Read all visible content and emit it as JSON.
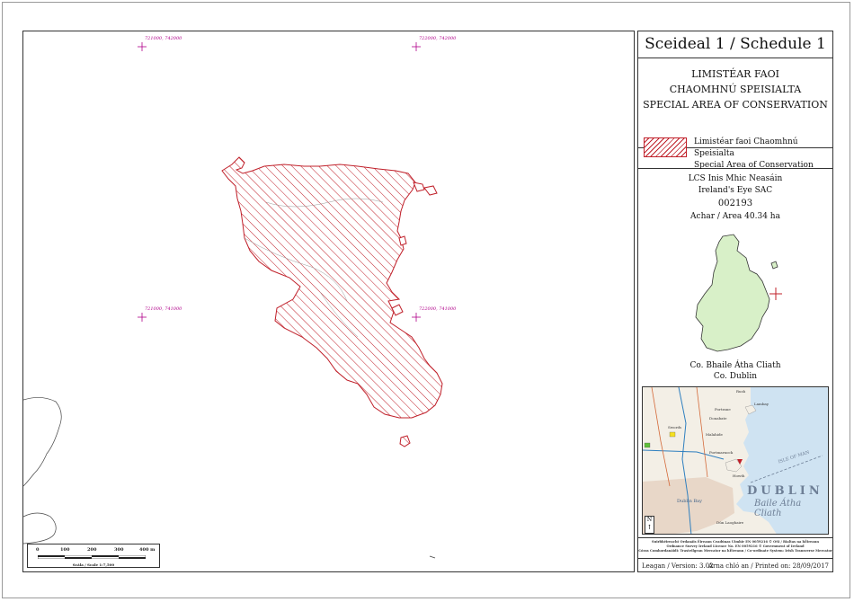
{
  "map": {
    "grid_labels": [
      "721000, 742000",
      "722000, 742000",
      "721000, 741000",
      "722000, 741000"
    ],
    "scale_ticks": [
      "0",
      "100",
      "200",
      "300",
      "400 m"
    ],
    "scale_caption": "Scála / Scale 1:7,500"
  },
  "panel": {
    "title": "Sceideal 1 / Schedule 1",
    "designation_lines": [
      "LIMISTÉAR FAOI",
      "CHAOMHNÚ SPEISIALTA",
      "SPECIAL AREA OF CONSERVATION"
    ],
    "legend_lines": [
      "Limistéar faoi Chaomhnú Speisialta",
      "Special Area of Conservation"
    ],
    "site_name_irish": "LCS Inis Mhic Neasáin",
    "site_name_english": "Ireland's Eye SAC",
    "site_code": "002193",
    "area": "Achar / Area 40.34 ha",
    "county_irish": "Co. Bhaile Átha Cliath",
    "county_english": "Co. Dublin",
    "inset": {
      "place_labels": [
        "Rush",
        "Lambay",
        "Portrane",
        "Donabate",
        "Malahide",
        "Swords",
        "Portmarnock",
        "Howth",
        "Dún Laoghaire"
      ],
      "dublin": "DUBLIN",
      "baile": "Baile Átha Cliath",
      "isle": "ISLE OF MAN",
      "bay": "Dublin Bay",
      "north": "N"
    },
    "copyright_lines": [
      "Suirbhéireacht Ordanáis Éireann Ceadúnas Uimhir EN 0059216 © OSi / Rialtas na hÉireann",
      "Ordnance Survey Ireland Licence No. EN 0059216 © Government of Ireland",
      "Córas Comhordanáidí: Trasteilgean Mercator na hÉireann / Co-ordinate System: Irish Transverse Mercator"
    ],
    "version": "Leagan / Version: 3.02",
    "printed": "Arna chló an / Printed on: 28/09/2017"
  },
  "colors": {
    "sac_outline": "#c0202a",
    "grid_label": "#b0008a",
    "county_fill": "#d8f0c8"
  }
}
